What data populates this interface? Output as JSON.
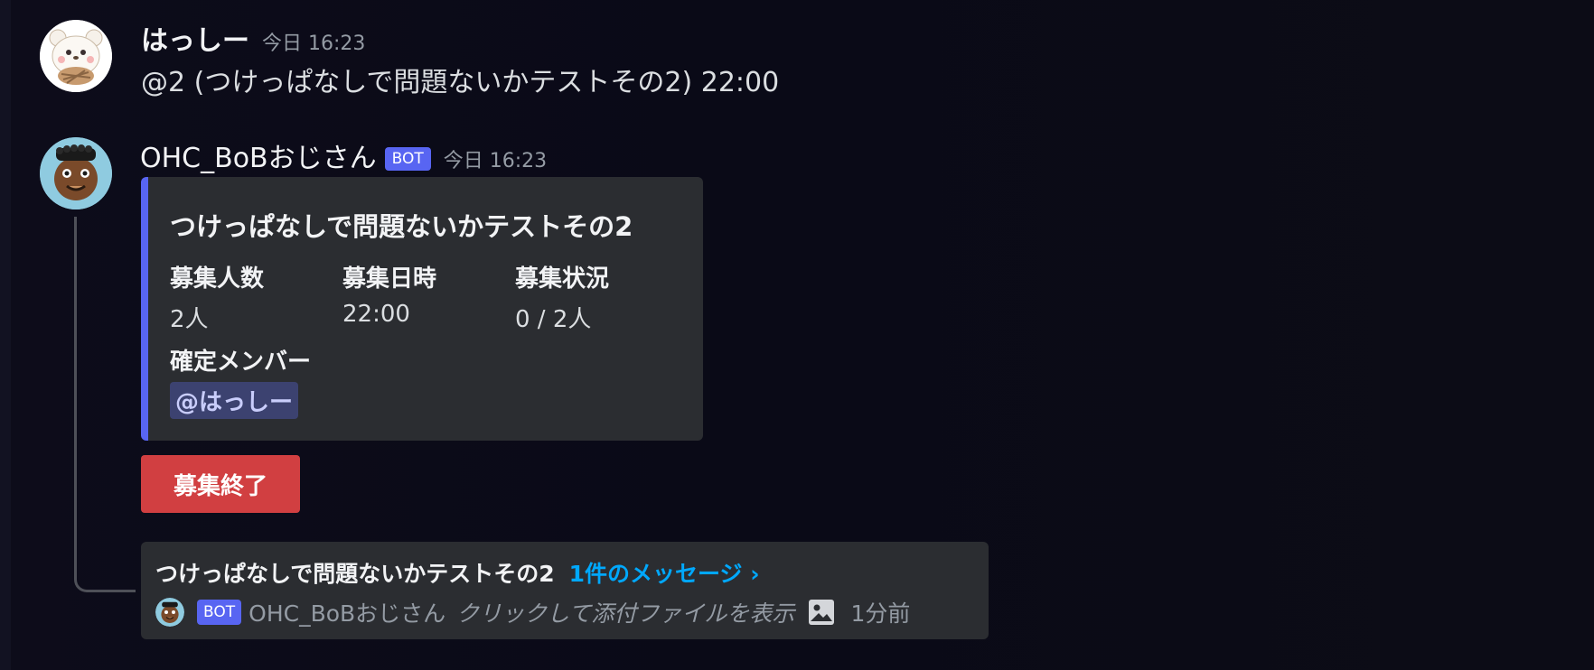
{
  "messages": [
    {
      "author": "はっしー",
      "timestamp": "今日 16:23",
      "content": "@2 (つけっぱなしで問題ないかテストその2) 22:00"
    },
    {
      "author": "OHC_BoBおじさん",
      "badge": "BOT",
      "timestamp": "今日 16:23"
    }
  ],
  "embed": {
    "accent_color": "#5865f2",
    "title": "つけっぱなしで問題ないかテストその2",
    "fields": [
      {
        "name": "募集人数",
        "value": "2人"
      },
      {
        "name": "募集日時",
        "value": "22:00"
      },
      {
        "name": "募集状況",
        "value": "0 / 2人"
      }
    ],
    "members_field": {
      "name": "確定メンバー",
      "value": "@はっしー"
    }
  },
  "button": {
    "label": "募集終了",
    "color": "#d13f41"
  },
  "thread": {
    "name": "つけっぱなしで問題ないかテストその2",
    "count_label": "1件のメッセージ ›",
    "preview": {
      "badge": "BOT",
      "author": "OHC_BoBおじさん",
      "text": "クリックして添付ファイルを表示",
      "icon": "image-icon",
      "time": "1分前"
    }
  }
}
